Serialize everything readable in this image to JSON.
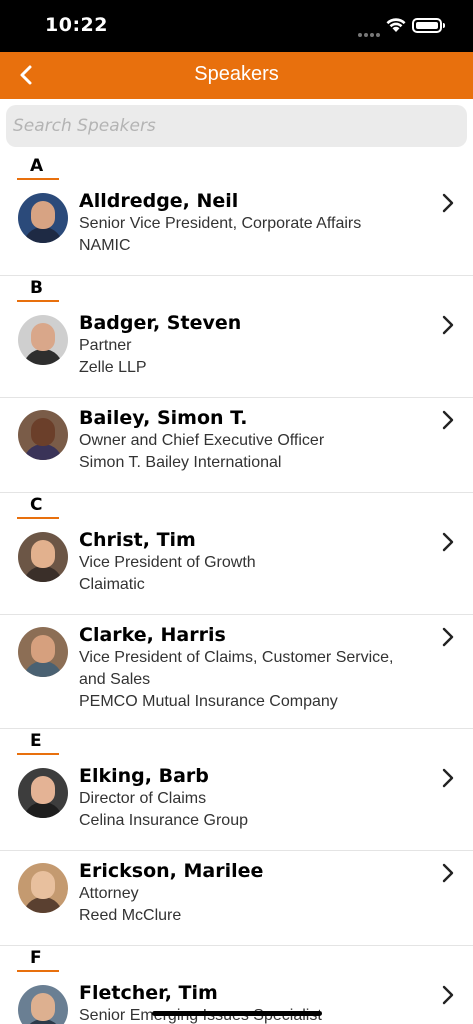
{
  "status_bar": {
    "time": "10:22"
  },
  "nav": {
    "title": "Speakers",
    "back_icon": "chevron-left-icon"
  },
  "search": {
    "placeholder": "Search Speakers",
    "value": ""
  },
  "accent_color": "#E8700D",
  "sections": [
    {
      "letter": "A",
      "speakers": [
        {
          "name": "Alldredge, Neil",
          "lines": [
            "Senior Vice President, Corporate Affairs",
            "NAMIC"
          ]
        }
      ]
    },
    {
      "letter": "B",
      "speakers": [
        {
          "name": "Badger, Steven",
          "lines": [
            "Partner",
            "Zelle LLP"
          ]
        },
        {
          "name": "Bailey, Simon T.",
          "lines": [
            "Owner and Chief Executive Officer",
            "Simon T. Bailey International"
          ]
        }
      ]
    },
    {
      "letter": "C",
      "speakers": [
        {
          "name": "Christ, Tim",
          "lines": [
            "Vice President of Growth",
            "Claimatic"
          ]
        },
        {
          "name": "Clarke, Harris",
          "lines": [
            "Vice President of Claims, Customer Service,",
            "and Sales",
            "PEMCO Mutual Insurance Company"
          ]
        }
      ]
    },
    {
      "letter": "E",
      "speakers": [
        {
          "name": "Elking, Barb",
          "lines": [
            "Director of Claims",
            "Celina Insurance Group"
          ]
        },
        {
          "name": "Erickson, Marilee",
          "lines": [
            "Attorney",
            "Reed McClure"
          ]
        }
      ]
    },
    {
      "letter": "F",
      "speakers": [
        {
          "name": "Fletcher, Tim",
          "lines": [
            "Senior Emerging Issues Specialist"
          ]
        }
      ]
    }
  ]
}
